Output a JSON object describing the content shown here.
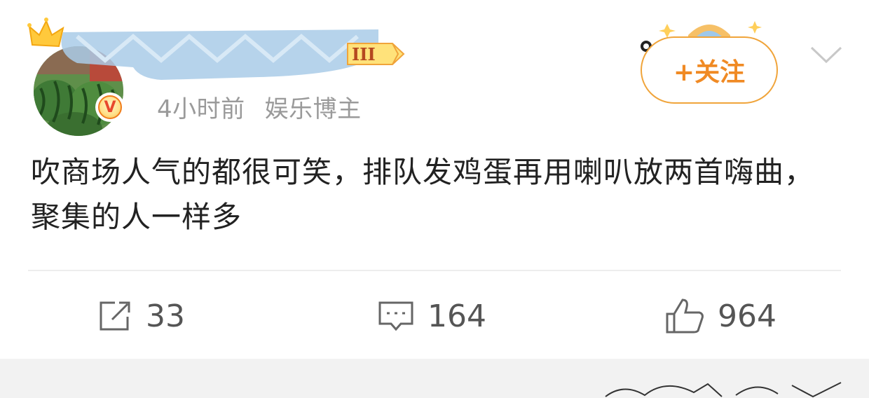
{
  "post": {
    "time": "4小时前",
    "user_tag": "娱乐博主",
    "level_label": "III",
    "follow_label": "+关注",
    "text": "吹商场人气的都很可笑，排队发鸡蛋再用喇叭放两首嗨曲，聚集的人一样多"
  },
  "actions": {
    "share_count": "33",
    "comment_count": "164",
    "like_count": "964"
  },
  "icons": [
    "crown-icon",
    "verified-v-icon",
    "level-badge-icon",
    "follow-decoration-icon",
    "chevron-down-icon",
    "share-icon",
    "comment-icon",
    "like-icon"
  ],
  "colors": {
    "accent_orange": "#f08a24",
    "follow_border": "#f0a43a",
    "verified_badge": "#f5a623",
    "meta_gray": "#9a9a9a",
    "text": "#222222",
    "blur_blue": "#9cc4e4"
  }
}
